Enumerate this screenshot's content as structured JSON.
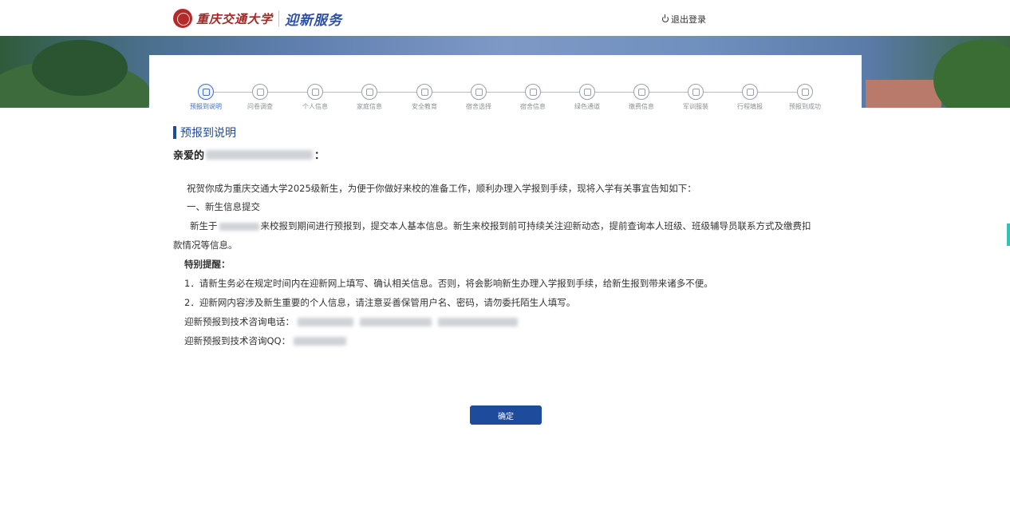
{
  "header": {
    "university_name": "重庆交通大学",
    "service_name": "迎新服务",
    "logout_label": "退出登录"
  },
  "steps": [
    {
      "label": "预报到说明",
      "icon": "document-icon",
      "active": true
    },
    {
      "label": "问卷调查",
      "icon": "clipboard-icon",
      "active": false
    },
    {
      "label": "个人信息",
      "icon": "person-icon",
      "active": false
    },
    {
      "label": "家庭信息",
      "icon": "home-icon",
      "active": false
    },
    {
      "label": "安全教育",
      "icon": "shield-icon",
      "active": false
    },
    {
      "label": "宿舍选择",
      "icon": "house-icon",
      "active": false
    },
    {
      "label": "宿舍信息",
      "icon": "umbrella-icon",
      "active": false
    },
    {
      "label": "绿色通道",
      "icon": "umbrella-icon",
      "active": false
    },
    {
      "label": "缴费信息",
      "icon": "coin-icon",
      "active": false
    },
    {
      "label": "军训服装",
      "icon": "shirt-icon",
      "active": false
    },
    {
      "label": "行程填报",
      "icon": "calendar-icon",
      "active": false
    },
    {
      "label": "预报到成功",
      "icon": "check-icon",
      "active": false
    }
  ],
  "content": {
    "section_title": "预报到说明",
    "greeting_prefix": "亲爱的",
    "greeting_suffix": "：",
    "intro": "祝贺你成为重庆交通大学2025级新生，为便于你做好来校的准备工作，顺利办理入学报到手续，现将入学有关事宜告知如下：",
    "heading_1": "一、新生信息提交",
    "para_1_prefix": "新生于",
    "para_1_line1": "来校报到期间进行预报到，提交本人基本信息。新生来校报到前可持续关注迎新动态，提前查询本人班级、班级辅导员联系方式及缴费扣",
    "para_1_line2": "款情况等信息。",
    "reminder_title": "特别提醒：",
    "reminder_1": "1．请新生务必在规定时间内在迎新网上填写、确认相关信息。否则，将会影响新生办理入学报到手续，给新生报到带来诸多不便。",
    "reminder_2": "2．迎新网内容涉及新生重要的个人信息，请注意妥善保管用户名、密码，请勿委托陌生人填写。",
    "phone_label": "迎新预报到技术咨询电话：",
    "qq_label": "迎新预报到技术咨询QQ："
  },
  "confirm_label": "确定",
  "colors": {
    "primary": "#1e4b9b",
    "active_step": "#3b6fd4",
    "brand_red": "#a52626"
  }
}
